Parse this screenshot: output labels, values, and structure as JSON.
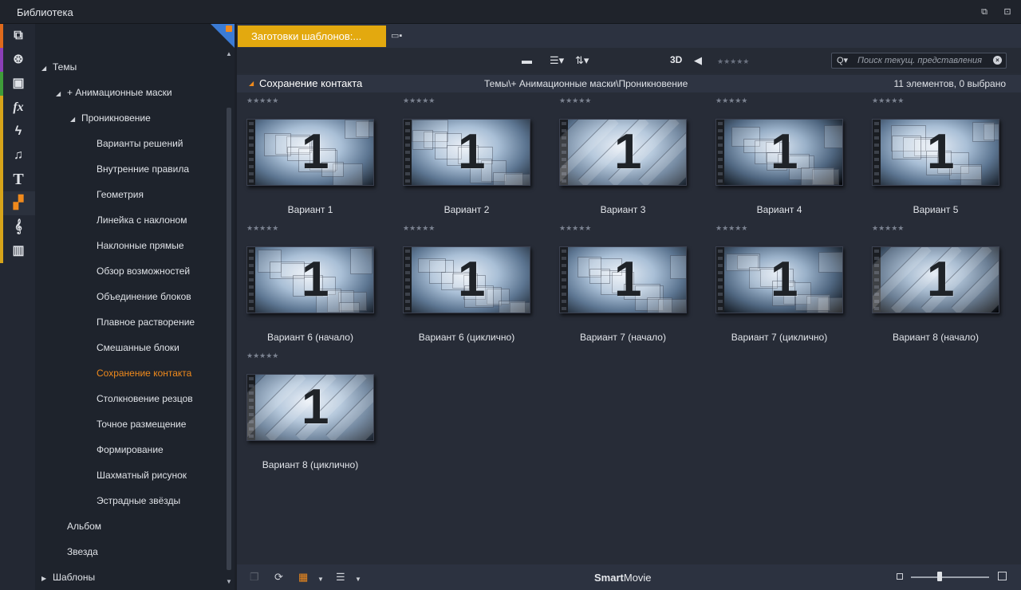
{
  "window": {
    "title": "Библиотека"
  },
  "strip": {
    "items": [
      {
        "icon": "box-icon",
        "glyph": "⧉",
        "color": "#e06a1c"
      },
      {
        "icon": "film-reel-icon",
        "glyph": "⊛",
        "color": "#8b3fb8"
      },
      {
        "icon": "layers-icon",
        "glyph": "▣",
        "color": "#3f9c3a"
      },
      {
        "icon": "fx-icon",
        "glyph": "fx",
        "color": "#d7a41a"
      },
      {
        "icon": "lightning-icon",
        "glyph": "ϟ",
        "color": "#d7a41a"
      },
      {
        "icon": "music-note-icon",
        "glyph": "♫",
        "color": "#d7a41a"
      },
      {
        "icon": "text-icon",
        "glyph": "T",
        "color": "#d7a41a"
      },
      {
        "icon": "montage-icon",
        "glyph": "▞",
        "color": "#d7a41a"
      },
      {
        "icon": "treble-clef-icon",
        "glyph": "𝄞",
        "color": "#d7a41a"
      },
      {
        "icon": "piano-icon",
        "glyph": "▥",
        "color": "#d7a41a"
      }
    ]
  },
  "tree": {
    "themes": "Темы",
    "anim_masks": "+ Анимационные маски",
    "penetration": "Проникновение",
    "children": [
      "Варианты решений",
      "Внутренние правила",
      "Геометрия",
      "Линейка с наклоном",
      "Наклонные прямые",
      "Обзор возможностей",
      "Объединение блоков",
      "Плавное растворение",
      "Смешанные блоки",
      "Сохранение контакта",
      "Столкновение резцов",
      "Точное размещение",
      "Формирование",
      "Шахматный рисунок",
      "Эстрадные звёзды"
    ],
    "album": "Альбом",
    "star": "Звезда",
    "templates": "Шаблоны"
  },
  "tab": {
    "label": "Заготовки шаблонов:..."
  },
  "toolbar": {
    "label_3d": "3D",
    "rating": "★★★★★"
  },
  "search": {
    "placeholder": "Поиск текущ. представления"
  },
  "pathbar": {
    "title": "Сохранение контакта",
    "path": "Темы\\+ Анимационные маски\\Проникновение",
    "count": "11 элементов, 0 выбрано"
  },
  "items": [
    {
      "label": "Вариант 1",
      "digit": "1",
      "stars": "★★★★★"
    },
    {
      "label": "Вариант 2",
      "digit": "1",
      "stars": "★★★★★"
    },
    {
      "label": "Вариант 3",
      "digit": "1",
      "stars": "★★★★★"
    },
    {
      "label": "Вариант 4",
      "digit": "1",
      "stars": "★★★★★"
    },
    {
      "label": "Вариант 5",
      "digit": "1",
      "stars": "★★★★★"
    },
    {
      "label": "Вариант 6 (начало)",
      "digit": "1",
      "stars": "★★★★★"
    },
    {
      "label": "Вариант 6 (циклично)",
      "digit": "1",
      "stars": "★★★★★"
    },
    {
      "label": "Вариант 7 (начало)",
      "digit": "1",
      "stars": "★★★★★"
    },
    {
      "label": "Вариант 7 (циклично)",
      "digit": "1",
      "stars": "★★★★★"
    },
    {
      "label": "Вариант 8 (начало)",
      "digit": "1",
      "stars": "★★★★★"
    },
    {
      "label": "Вариант 8 (циклично)",
      "digit": "1",
      "stars": "★★★★★"
    }
  ],
  "brand": {
    "bold": "Smart",
    "rest": "Movie"
  },
  "colors": {
    "accent": "#f08a1c",
    "tab": "#e3a90f",
    "corner": "#3b7bd4"
  }
}
